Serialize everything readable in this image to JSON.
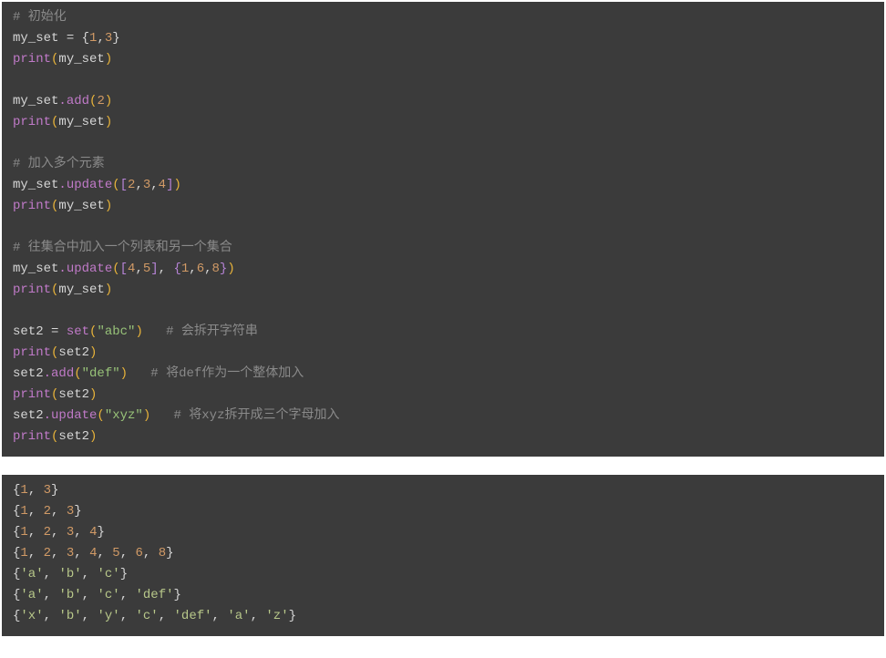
{
  "code": {
    "l1": "# 初始化",
    "l2a": "my_set",
    "l2b": " = {",
    "l2c": "1",
    "l2d": ",",
    "l2e": "3",
    "l2f": "}",
    "l3a": "print",
    "l3b": "(",
    "l3c": "my_set",
    "l3d": ")",
    "l5a": "my_set",
    "l5b": ".add",
    "l5c": "(",
    "l5d": "2",
    "l5e": ")",
    "l6a": "print",
    "l6b": "(",
    "l6c": "my_set",
    "l6d": ")",
    "l8": "# 加入多个元素",
    "l9a": "my_set",
    "l9b": ".update",
    "l9c": "(",
    "l9d": "[",
    "l9e": "2",
    "l9f": ",",
    "l9g": "3",
    "l9h": ",",
    "l9i": "4",
    "l9j": "]",
    "l9k": ")",
    "l10a": "print",
    "l10b": "(",
    "l10c": "my_set",
    "l10d": ")",
    "l12": "# 往集合中加入一个列表和另一个集合",
    "l13a": "my_set",
    "l13b": ".update",
    "l13c": "(",
    "l13d": "[",
    "l13e": "4",
    "l13f": ",",
    "l13g": "5",
    "l13h": "]",
    "l13i": ", ",
    "l13j": "{",
    "l13k": "1",
    "l13l": ",",
    "l13m": "6",
    "l13n": ",",
    "l13o": "8",
    "l13p": "}",
    "l13q": ")",
    "l14a": "print",
    "l14b": "(",
    "l14c": "my_set",
    "l14d": ")",
    "l16a": "set2",
    "l16b": " = ",
    "l16c": "set",
    "l16d": "(",
    "l16e": "\"abc\"",
    "l16f": ")",
    "l16g": "   ",
    "l16h": "# 会拆开字符串",
    "l17a": "print",
    "l17b": "(",
    "l17c": "set2",
    "l17d": ")",
    "l18a": "set2",
    "l18b": ".add",
    "l18c": "(",
    "l18d": "\"def\"",
    "l18e": ")",
    "l18f": "   ",
    "l18g": "# 将def作为一个整体加入",
    "l19a": "print",
    "l19b": "(",
    "l19c": "set2",
    "l19d": ")",
    "l20a": "set2",
    "l20b": ".update",
    "l20c": "(",
    "l20d": "\"xyz\"",
    "l20e": ")",
    "l20f": "   ",
    "l20g": "# 将xyz拆开成三个字母加入",
    "l21a": "print",
    "l21b": "(",
    "l21c": "set2",
    "l21d": ")"
  },
  "output": {
    "o1": "{1, 3}",
    "o2": "{1, 2, 3}",
    "o3": "{1, 2, 3, 4}",
    "o4": "{1, 2, 3, 4, 5, 6, 8}",
    "o5": "{'a', 'b', 'c'}",
    "o6": "{'a', 'b', 'c', 'def'}",
    "o7": "{'x', 'b', 'y', 'c', 'def', 'a', 'z'}"
  }
}
